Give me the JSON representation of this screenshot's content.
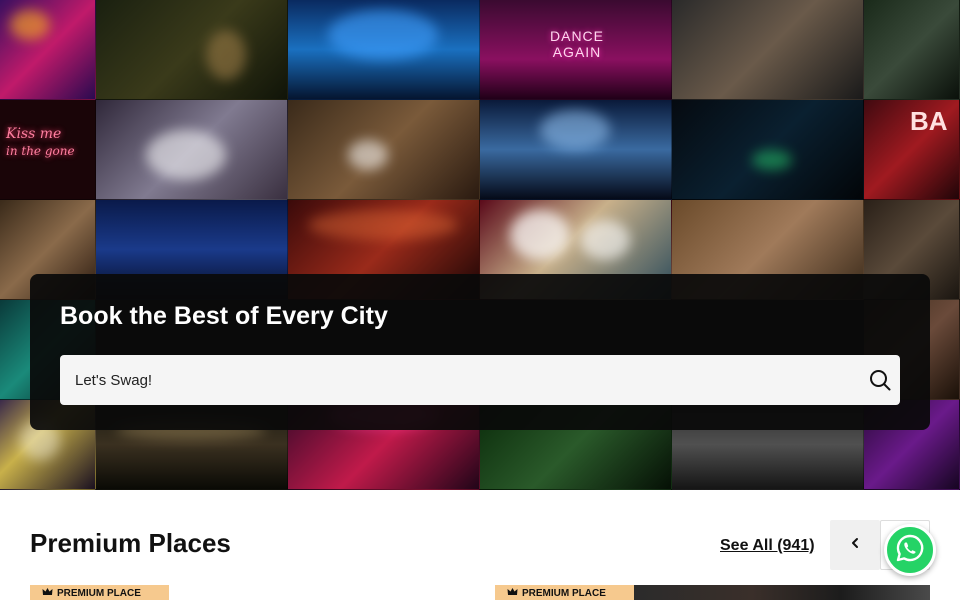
{
  "hero": {
    "title": "Book the Best of Every City",
    "search": {
      "placeholder": "Let's Swag!",
      "value": ""
    },
    "neon_sign_1": "Kiss me",
    "neon_sign_2": "in the gone",
    "neon_sign_3_line1": "DANCE",
    "neon_sign_3_line2": "AGAIN",
    "neon_sign_4": "BA"
  },
  "premium_section": {
    "title": "Premium Places",
    "see_all_label": "See All (941)",
    "cards": [
      {
        "badge": "PREMIUM PLACE"
      },
      {
        "badge": "PREMIUM PLACE"
      }
    ]
  },
  "icons": {
    "search": "search-icon",
    "prev": "chevron-left-icon",
    "next": "chevron-right-icon",
    "whatsapp": "whatsapp-icon",
    "crown": "crown-icon"
  },
  "colors": {
    "accent_badge": "#f6c98e",
    "whatsapp": "#25d366",
    "hero_card": "#0a0a0a"
  }
}
